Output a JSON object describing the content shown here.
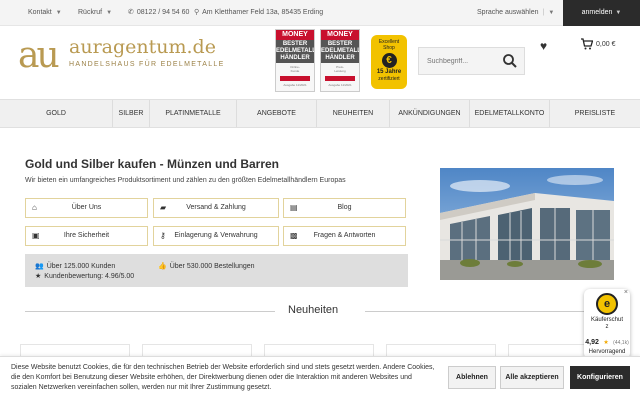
{
  "topbar": {
    "contact": "Kontakt",
    "callback": "Rückruf",
    "phone": "08122 / 94 54 60",
    "address": "Am Kletthamer Feld 13a, 85435 Erding",
    "language": "Sprache auswählen",
    "login": "anmelden"
  },
  "logo": {
    "mark": "au",
    "name": "auragentum.de",
    "tagline": "HANDELSHAUS FÜR EDELMETALLE"
  },
  "badges": [
    {
      "brand": "MONEY",
      "line1": "BESTER",
      "line2": "EDELMETALL-",
      "line3": "HÄNDLER",
      "small1": "Online-",
      "small2": "Kunde",
      "small3": "Ausgabe 11/2021"
    },
    {
      "brand": "MONEY",
      "line1": "BESTER",
      "line2": "EDELMETALL-",
      "line3": "HÄNDLER",
      "small1": "Preis-",
      "small2": "Leistung",
      "small3": "Ausgabe 11/2021"
    }
  ],
  "excellent_shop": {
    "line1": "Excellent",
    "line2": "Shop",
    "years": "15 Jahre",
    "sub": "zertifiziert"
  },
  "search": {
    "placeholder": "Suchbegriff..."
  },
  "cart": {
    "total": "0,00 €"
  },
  "nav": [
    {
      "label": "GOLD"
    },
    {
      "label": "SILBER"
    },
    {
      "label": "PLATINMETALLE"
    },
    {
      "label": "ANGEBOTE"
    },
    {
      "label": "NEUHEITEN"
    },
    {
      "label": "ANKÜNDIGUNGEN"
    },
    {
      "label": "EDELMETALLKONTO"
    },
    {
      "label": "PREISLISTE"
    }
  ],
  "main": {
    "heading": "Gold und Silber kaufen - Münzen und Barren",
    "intro": "Wir bieten ein umfangreiches Produktsortiment und zählen zu den größten Edelmetallhändlern Europas"
  },
  "quick_links": [
    {
      "label": "Über Uns",
      "icon": "home-icon"
    },
    {
      "label": "Versand & Zahlung",
      "icon": "truck-icon"
    },
    {
      "label": "Blog",
      "icon": "document-icon"
    },
    {
      "label": "Ihre Sicherheit",
      "icon": "lock-icon"
    },
    {
      "label": "Einlagerung & Verwahrung",
      "icon": "key-icon"
    },
    {
      "label": "Fragen & Antworten",
      "icon": "chat-icon"
    }
  ],
  "stats": {
    "customers": "Über 125.000 Kunden",
    "orders": "Über 530.000 Bestellungen",
    "rating": "Kundenbewertung: 4.96/5.00"
  },
  "section": {
    "title": "Neuheiten"
  },
  "trusted": {
    "label1": "Käuferschut",
    "label2": "z",
    "score": "4,92",
    "count": "(44,1k)",
    "rating": "Hervorragend"
  },
  "cookie": {
    "text": "Diese Website benutzt Cookies, die für den technischen Betrieb der Website erforderlich sind und stets gesetzt werden. Andere Cookies, die den Komfort bei Benutzung dieser Website erhöhen, der Direktwerbung dienen oder die Interaktion mit anderen Websites und sozialen Netzwerken vereinfachen sollen, werden nur mit Ihrer Zustimmung gesetzt.",
    "reject": "Ablehnen",
    "accept_all": "Alle akzeptieren",
    "configure": "Konfigurieren"
  },
  "colors": {
    "gold": "#b99a52",
    "dark": "#2b2b2b",
    "button_border": "#e2d39c",
    "money_red": "#c8102e",
    "shop_yellow": "#f2c200"
  }
}
